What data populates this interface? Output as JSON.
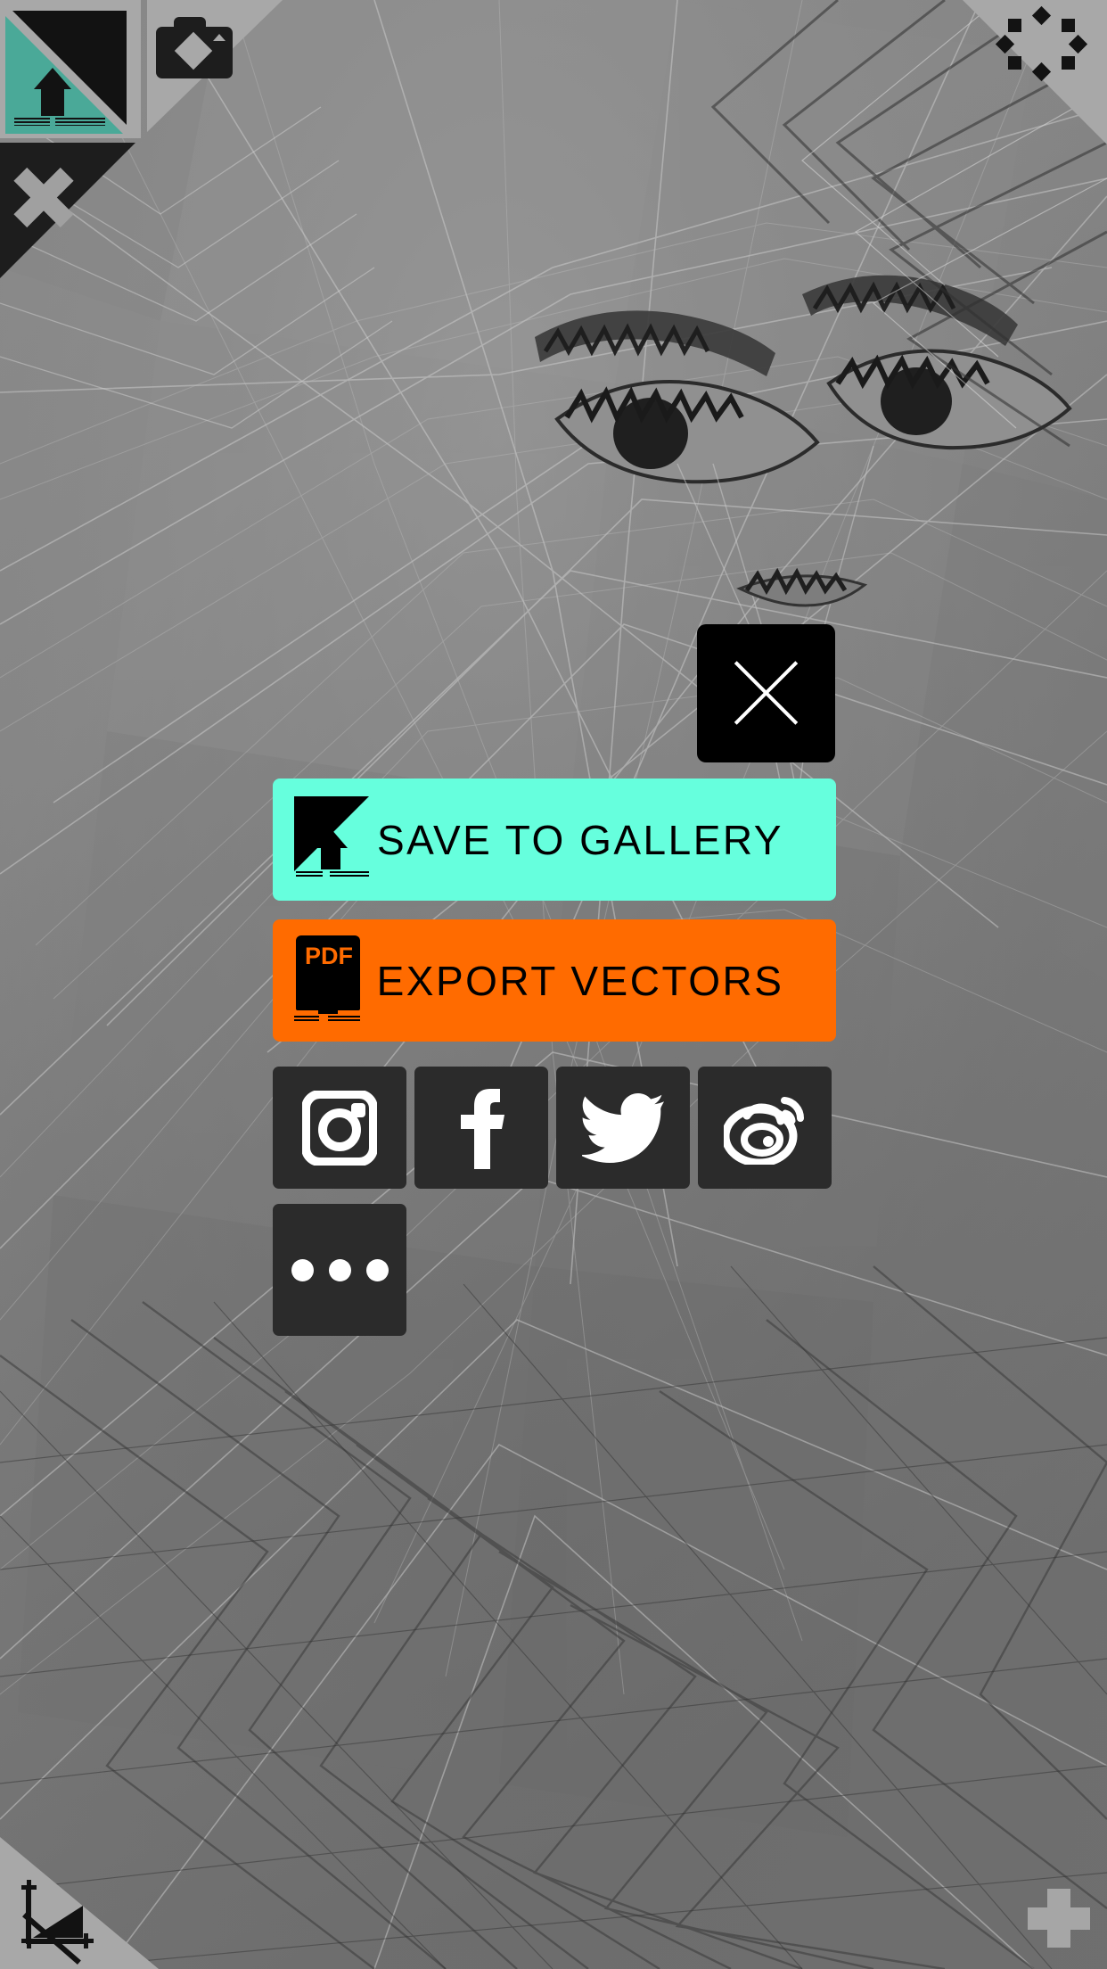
{
  "screen": {
    "title": "Share / Export sheet",
    "background_description": "grayscale low-poly triangulated portrait artwork"
  },
  "colors": {
    "accent_teal": "#66FFDD",
    "accent_orange": "#FF6B00",
    "tile_dark": "#2b2b2b",
    "close_black": "#000000",
    "corner_gray": "#a8a8a8",
    "corner_black": "#1d1d1d",
    "canvas_gray": "#787878"
  },
  "corner_tools": {
    "save_icon": "save-to-gallery-triangle-icon",
    "camera_icon": "camera-icon",
    "close_icon": "close-x-icon",
    "pattern_icon": "point-pattern-icon",
    "geometry_icon": "triangle-nodes-icon",
    "add_icon": "plus-icon"
  },
  "share_sheet": {
    "close_label": "close-icon",
    "actions": [
      {
        "id": "save-gallery",
        "label": "SAVE TO GALLERY",
        "icon": "save-arrow-icon",
        "color": "#66FFDD"
      },
      {
        "id": "export-vectors",
        "label": "EXPORT VECTORS",
        "icon": "pdf-export-icon",
        "icon_text": "PDF",
        "color": "#FF6B00"
      }
    ],
    "social": [
      {
        "id": "instagram",
        "icon": "instagram-icon"
      },
      {
        "id": "facebook",
        "icon": "facebook-icon"
      },
      {
        "id": "twitter",
        "icon": "twitter-icon"
      },
      {
        "id": "weibo",
        "icon": "weibo-icon"
      }
    ],
    "more": {
      "id": "more",
      "icon": "more-dots-icon"
    }
  }
}
